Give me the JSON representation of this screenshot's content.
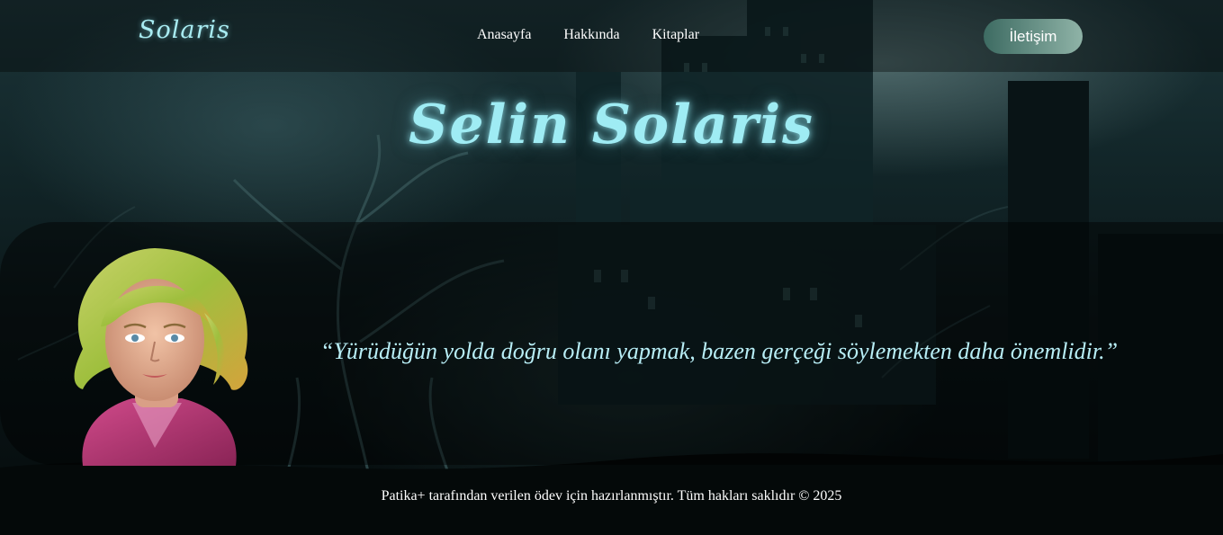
{
  "header": {
    "logo_text": "Solaris",
    "nav": [
      {
        "label": "Anasayfa"
      },
      {
        "label": "Hakkında"
      },
      {
        "label": "Kitaplar"
      }
    ],
    "contact_label": "İletişim"
  },
  "hero": {
    "title": "Selin Solaris",
    "quote": "“Yürüdüğün yolda doğru olanı yapmak, bazen gerçeği söylemekten daha önemlidir.”"
  },
  "footer": {
    "text": "Patika+ tarafından verilen ödev için hazırlanmıştır. Tüm hakları saklıdır © 2025"
  },
  "colors": {
    "accent": "#9fecf4",
    "button_start": "#3d6b62",
    "button_end": "#8fb3a7"
  },
  "icons": {
    "avatar": "character-portrait"
  }
}
